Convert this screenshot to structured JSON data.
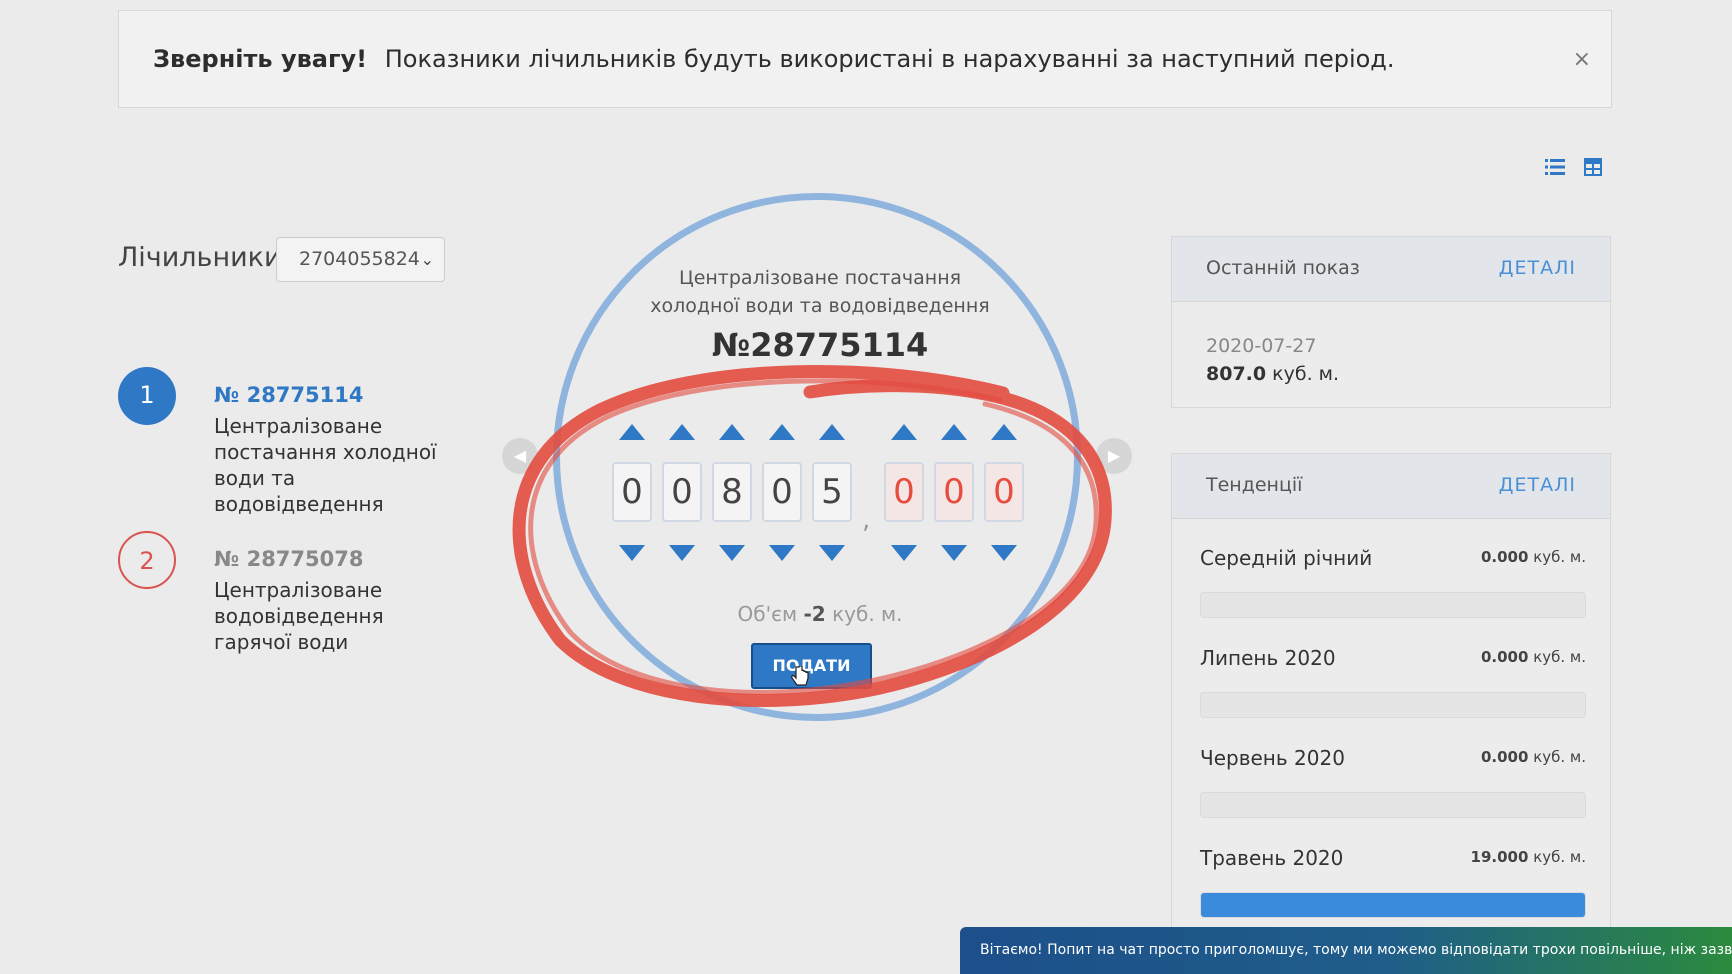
{
  "alert": {
    "title": "Зверніть увагу!",
    "message": "Показники лічильників будуть використані в нарахуванні за наступний період.",
    "close_icon": "×"
  },
  "view_toggle": {
    "list_icon": "list-icon",
    "grid_icon": "grid-icon",
    "active": "grid"
  },
  "meters": {
    "label": "Лічильники",
    "selected_account": "2704055824",
    "items": [
      {
        "index": "1",
        "number": "№ 28775114",
        "description": "Централізоване постачання холодної води та водовідведення",
        "active": true
      },
      {
        "index": "2",
        "number": "№ 28775078",
        "description": "Централізоване водовідведення гарячої води",
        "active": false
      }
    ]
  },
  "reading": {
    "service_line1": "Централізоване постачання",
    "service_line2": "холодної води та водовідведення",
    "meter_number": "№28775114",
    "integer_digits": [
      "0",
      "0",
      "8",
      "0",
      "5"
    ],
    "decimal_digits": [
      "0",
      "0",
      "0"
    ],
    "comma": ",",
    "volume_prefix": "Об'єм",
    "volume_value": "-2",
    "volume_unit": "куб. м.",
    "submit_label": "ПОДАТИ"
  },
  "last_reading": {
    "title": "Останній показ",
    "details_label": "ДЕТАЛІ",
    "date": "2020-07-27",
    "value": "807.0",
    "unit": "куб. м."
  },
  "trends": {
    "title": "Тенденції",
    "details_label": "ДЕТАЛІ",
    "unit": "куб. м.",
    "rows": [
      {
        "label": "Середній річний",
        "value": "0.000",
        "fill": 0
      },
      {
        "label": "Липень 2020",
        "value": "0.000",
        "fill": 0
      },
      {
        "label": "Червень 2020",
        "value": "0.000",
        "fill": 0
      },
      {
        "label": "Травень 2020",
        "value": "19.000",
        "fill": 1
      }
    ]
  },
  "chat": {
    "message": "Вітаємо! Попит на чат просто приголомшує, тому ми можемо відповідати трохи повільніше, ніж зазвичай"
  },
  "colors": {
    "primary": "#2e78c5",
    "danger": "#d9534f",
    "circle": "#8fb4de",
    "annotation": "#e34b3f"
  }
}
